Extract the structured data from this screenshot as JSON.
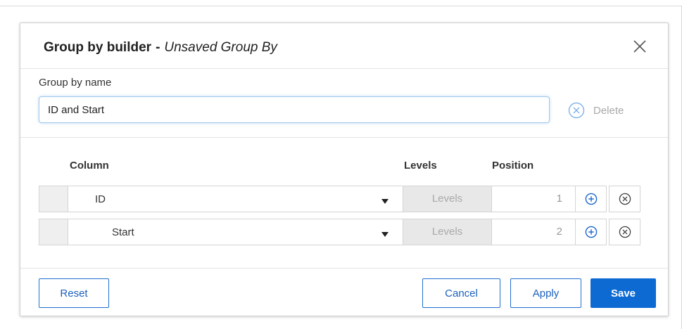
{
  "dialog": {
    "title": "Group by builder",
    "title_separator": "-",
    "subtitle": "Unsaved Group By",
    "close_icon": "close-icon"
  },
  "group_name": {
    "label": "Group by name",
    "value": "ID and Start",
    "delete_label": "Delete",
    "delete_icon": "circle-x-icon"
  },
  "table": {
    "headers": {
      "column": "Column",
      "levels": "Levels",
      "position": "Position"
    },
    "rows": [
      {
        "column": "ID",
        "levels": "Levels",
        "position": "1"
      },
      {
        "column": "Start",
        "levels": "Levels",
        "position": "2"
      }
    ],
    "add_icon": "circle-plus-icon",
    "remove_icon": "circle-x-icon",
    "dropdown_icon": "caret-down-icon"
  },
  "footer": {
    "reset": "Reset",
    "cancel": "Cancel",
    "apply": "Apply",
    "save": "Save"
  },
  "colors": {
    "accent": "#0d6ad3",
    "input_focus": "#9fc7ec",
    "disabled_text": "#a9a9a9",
    "delete_icon": "#7fb2e5"
  }
}
